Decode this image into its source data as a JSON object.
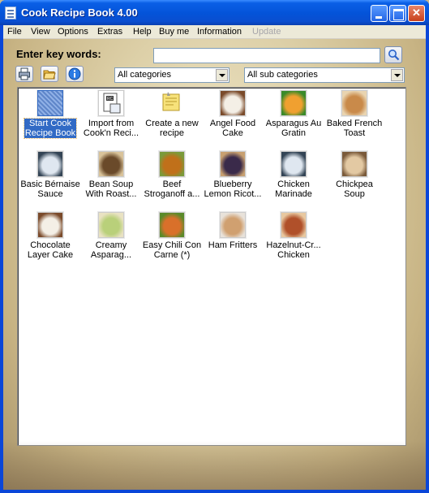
{
  "window": {
    "title": "Cook Recipe Book 4.00"
  },
  "menu": [
    "File",
    "View",
    "Options",
    "Extras",
    "Help",
    "Buy me",
    "Information",
    "Update"
  ],
  "search": {
    "label": "Enter key words:",
    "value": ""
  },
  "toolbar": {
    "print_icon": "printer-icon",
    "open_icon": "folder-open-icon",
    "info_icon": "info-icon",
    "search_icon": "search-icon"
  },
  "filters": {
    "category": "All categories",
    "subcategory": "All sub categories"
  },
  "recipes": [
    {
      "line1": "Start Cook",
      "line2": "Recipe Book",
      "icon": "cookbook-icon",
      "selected": true
    },
    {
      "line1": "Import from",
      "line2": "Cook'n Reci...",
      "icon": "import-icon"
    },
    {
      "line1": "Create a new",
      "line2": "recipe",
      "icon": "new-recipe-icon"
    },
    {
      "line1": "Angel Food",
      "line2": "Cake",
      "icon": "cake-photo"
    },
    {
      "line1": "Asparagus Au",
      "line2": "Gratin",
      "icon": "dish-photo"
    },
    {
      "line1": "Baked French",
      "line2": "Toast",
      "icon": "toast-photo"
    },
    {
      "line1": "Basic Bérnaise",
      "line2": "Sauce",
      "icon": "placeholder-photo"
    },
    {
      "line1": "Bean Soup",
      "line2": "With Roast...",
      "icon": "soup-photo"
    },
    {
      "line1": "Beef",
      "line2": "Stroganoff a...",
      "icon": "beef-photo"
    },
    {
      "line1": "Blueberry",
      "line2": "Lemon Ricot...",
      "icon": "blueberry-photo"
    },
    {
      "line1": "Chicken",
      "line2": "Marinade",
      "icon": "placeholder-photo"
    },
    {
      "line1": "Chickpea",
      "line2": "Soup",
      "icon": "chickpea-photo"
    },
    {
      "line1": "Chocolate",
      "line2": "Layer Cake",
      "icon": "cake-photo"
    },
    {
      "line1": "Creamy",
      "line2": "Asparag...",
      "icon": "asparagus-photo"
    },
    {
      "line1": "Easy Chili Con",
      "line2": "Carne (*)",
      "icon": "chili-photo"
    },
    {
      "line1": "Ham Fritters",
      "line2": "",
      "icon": "fritters-photo"
    },
    {
      "line1": "Hazelnut-Cr...",
      "line2": "Chicken",
      "icon": "chicken-photo"
    }
  ]
}
